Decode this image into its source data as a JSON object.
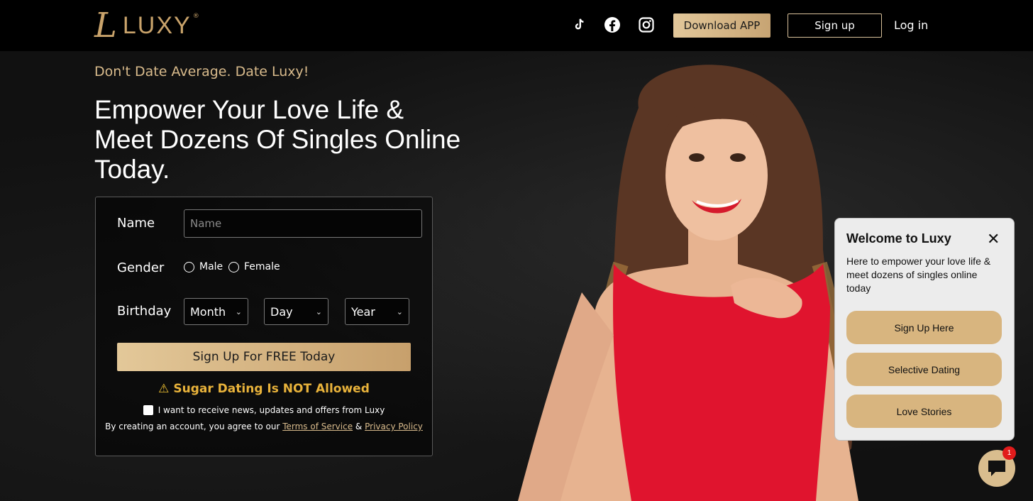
{
  "header": {
    "logo_text": "LUXY",
    "logo_mark": "L",
    "logo_reg": "®",
    "social_icons": [
      "tiktok-icon",
      "facebook-icon",
      "instagram-icon"
    ],
    "download_label": "Download APP",
    "signup_label": "Sign up",
    "login_label": "Log in"
  },
  "hero": {
    "tagline": "Don't Date Average. Date Luxy!",
    "headline": "Empower Your Love Life & Meet Dozens Of Singles Online Today."
  },
  "form": {
    "name_label": "Name",
    "name_placeholder": "Name",
    "name_value": "",
    "gender_label": "Gender",
    "gender_options": [
      "Male",
      "Female"
    ],
    "birthday_label": "Birthday",
    "month": "Month",
    "day": "Day",
    "year": "Year",
    "submit_label": "Sign Up For FREE Today",
    "warning": "Sugar Dating Is NOT Allowed",
    "newsletter_label": "I want to receive news, updates and offers from Luxy",
    "terms_prefix": "By creating an account, you agree to our",
    "terms_link": "Terms of Service",
    "terms_amp": "&",
    "privacy_link": "Privacy Policy"
  },
  "chat": {
    "title": "Welcome to Luxy",
    "message": "Here to empower your love life & meet dozens of singles online today",
    "buttons": [
      "Sign Up Here",
      "Selective Dating",
      "Love Stories"
    ],
    "badge_count": "1"
  },
  "colors": {
    "accent_gold": "#d8b57f",
    "warning": "#e9b33b",
    "dress_red": "#e0142e"
  }
}
